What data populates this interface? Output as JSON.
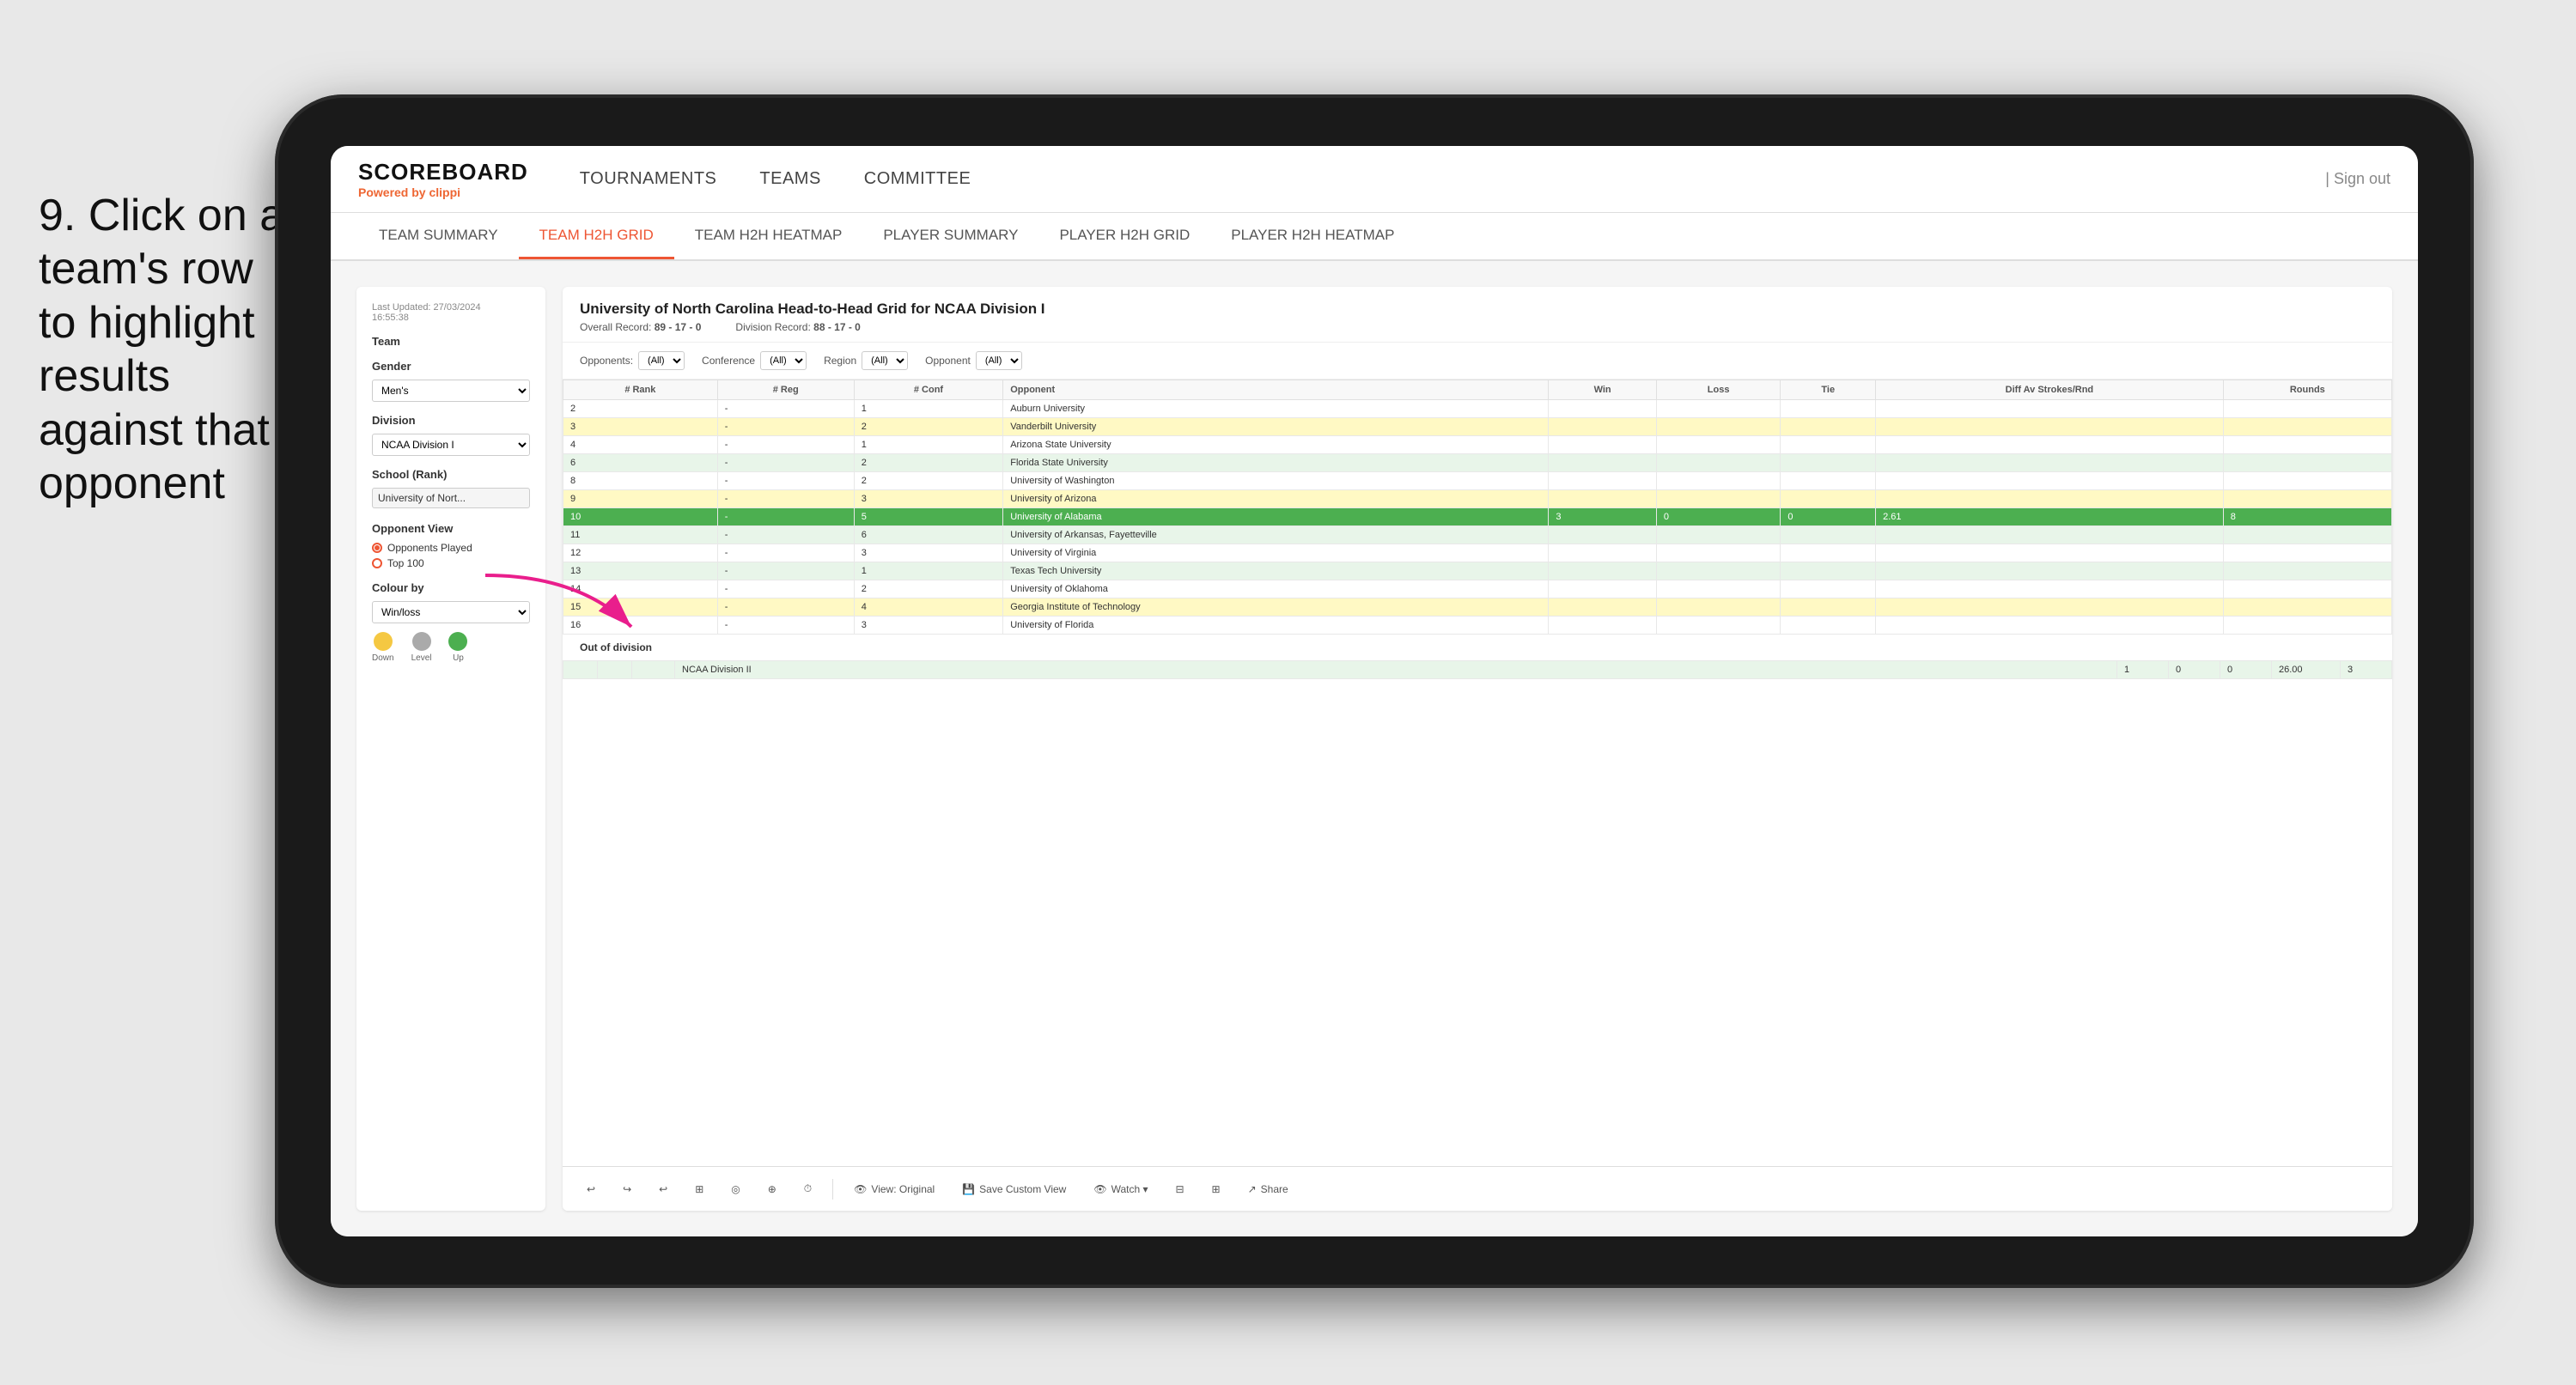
{
  "instruction": {
    "step": "9.",
    "text": "Click on a team's row to highlight results against that opponent"
  },
  "brand": {
    "name": "SCOREBOARD",
    "powered_label": "Powered by",
    "powered_brand": "clippi"
  },
  "nav": {
    "links": [
      "TOURNAMENTS",
      "TEAMS",
      "COMMITTEE"
    ],
    "sign_out": "Sign out"
  },
  "sub_tabs": [
    {
      "label": "TEAM SUMMARY",
      "active": false
    },
    {
      "label": "TEAM H2H GRID",
      "active": true
    },
    {
      "label": "TEAM H2H HEATMAP",
      "active": false
    },
    {
      "label": "PLAYER SUMMARY",
      "active": false
    },
    {
      "label": "PLAYER H2H GRID",
      "active": false
    },
    {
      "label": "PLAYER H2H HEATMAP",
      "active": false
    }
  ],
  "left_panel": {
    "timestamp_label": "Last Updated: 27/03/2024",
    "timestamp_time": "16:55:38",
    "team_label": "Team",
    "gender_label": "Gender",
    "gender_value": "Men's",
    "division_label": "Division",
    "division_value": "NCAA Division I",
    "school_label": "School (Rank)",
    "school_value": "University of Nort...",
    "opponent_view_label": "Opponent View",
    "radio_options": [
      {
        "label": "Opponents Played",
        "checked": true
      },
      {
        "label": "Top 100",
        "checked": false
      }
    ],
    "colour_by_label": "Colour by",
    "colour_by_value": "Win/loss",
    "colours": [
      {
        "color": "#f5c842",
        "label": "Down"
      },
      {
        "color": "#aaa",
        "label": "Level"
      },
      {
        "color": "#4caf50",
        "label": "Up"
      }
    ]
  },
  "grid": {
    "title": "University of North Carolina Head-to-Head Grid for NCAA Division I",
    "overall_record_label": "Overall Record:",
    "overall_record": "89 - 17 - 0",
    "division_record_label": "Division Record:",
    "division_record": "88 - 17 - 0",
    "filters": {
      "opponents_label": "Opponents:",
      "opponents_value": "(All)",
      "conference_label": "Conference",
      "conference_value": "(All)",
      "region_label": "Region",
      "region_value": "(All)",
      "opponent_label": "Opponent",
      "opponent_value": "(All)"
    },
    "columns": [
      "# Rank",
      "# Reg",
      "# Conf",
      "Opponent",
      "Win",
      "Loss",
      "Tie",
      "Diff Av Strokes/Rnd",
      "Rounds"
    ],
    "rows": [
      {
        "rank": "2",
        "reg": "-",
        "conf": "1",
        "opponent": "Auburn University",
        "win": "",
        "loss": "",
        "tie": "",
        "diff": "",
        "rounds": "",
        "highlight": false,
        "row_bg": ""
      },
      {
        "rank": "3",
        "reg": "-",
        "conf": "2",
        "opponent": "Vanderbilt University",
        "win": "",
        "loss": "",
        "tie": "",
        "diff": "",
        "rounds": "",
        "highlight": false,
        "row_bg": "cell-yellow-light"
      },
      {
        "rank": "4",
        "reg": "-",
        "conf": "1",
        "opponent": "Arizona State University",
        "win": "",
        "loss": "",
        "tie": "",
        "diff": "",
        "rounds": "",
        "highlight": false,
        "row_bg": ""
      },
      {
        "rank": "6",
        "reg": "-",
        "conf": "2",
        "opponent": "Florida State University",
        "win": "",
        "loss": "",
        "tie": "",
        "diff": "",
        "rounds": "",
        "highlight": false,
        "row_bg": "cell-green-light"
      },
      {
        "rank": "8",
        "reg": "-",
        "conf": "2",
        "opponent": "University of Washington",
        "win": "",
        "loss": "",
        "tie": "",
        "diff": "",
        "rounds": "",
        "highlight": false,
        "row_bg": ""
      },
      {
        "rank": "9",
        "reg": "-",
        "conf": "3",
        "opponent": "University of Arizona",
        "win": "",
        "loss": "",
        "tie": "",
        "diff": "",
        "rounds": "",
        "highlight": false,
        "row_bg": "cell-yellow-light"
      },
      {
        "rank": "10",
        "reg": "-",
        "conf": "5",
        "opponent": "University of Alabama",
        "win": "3",
        "loss": "0",
        "tie": "0",
        "diff": "2.61",
        "rounds": "8",
        "highlight": true,
        "row_bg": ""
      },
      {
        "rank": "11",
        "reg": "-",
        "conf": "6",
        "opponent": "University of Arkansas, Fayetteville",
        "win": "",
        "loss": "",
        "tie": "",
        "diff": "",
        "rounds": "",
        "highlight": false,
        "row_bg": "cell-green-light"
      },
      {
        "rank": "12",
        "reg": "-",
        "conf": "3",
        "opponent": "University of Virginia",
        "win": "",
        "loss": "",
        "tie": "",
        "diff": "",
        "rounds": "",
        "highlight": false,
        "row_bg": ""
      },
      {
        "rank": "13",
        "reg": "-",
        "conf": "1",
        "opponent": "Texas Tech University",
        "win": "",
        "loss": "",
        "tie": "",
        "diff": "",
        "rounds": "",
        "highlight": false,
        "row_bg": "cell-green-light"
      },
      {
        "rank": "14",
        "reg": "-",
        "conf": "2",
        "opponent": "University of Oklahoma",
        "win": "",
        "loss": "",
        "tie": "",
        "diff": "",
        "rounds": "",
        "highlight": false,
        "row_bg": ""
      },
      {
        "rank": "15",
        "reg": "-",
        "conf": "4",
        "opponent": "Georgia Institute of Technology",
        "win": "",
        "loss": "",
        "tie": "",
        "diff": "",
        "rounds": "",
        "highlight": false,
        "row_bg": "cell-yellow-light"
      },
      {
        "rank": "16",
        "reg": "-",
        "conf": "3",
        "opponent": "University of Florida",
        "win": "",
        "loss": "",
        "tie": "",
        "diff": "",
        "rounds": "",
        "highlight": false,
        "row_bg": ""
      }
    ],
    "out_of_division_label": "Out of division",
    "out_division_rows": [
      {
        "label": "NCAA Division II",
        "win": "1",
        "loss": "0",
        "tie": "0",
        "diff": "26.00",
        "rounds": "3"
      }
    ]
  },
  "toolbar": {
    "buttons": [
      "View: Original",
      "Save Custom View",
      "Watch ▾",
      "Share"
    ]
  }
}
